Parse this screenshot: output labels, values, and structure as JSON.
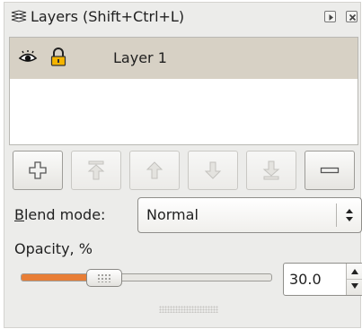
{
  "panel": {
    "title": "Layers (Shift+Ctrl+L)",
    "title_icon": "layers-icon",
    "buttons": [
      {
        "icon": "dock-toggle-icon"
      },
      {
        "icon": "close-icon"
      }
    ]
  },
  "layers": [
    {
      "name": "Layer 1",
      "visible": true,
      "locked": true,
      "selected": true
    }
  ],
  "toolbar": [
    {
      "icon": "add-layer-icon",
      "enabled": true
    },
    {
      "icon": "raise-to-top-icon",
      "enabled": false
    },
    {
      "icon": "raise-layer-icon",
      "enabled": false
    },
    {
      "icon": "lower-layer-icon",
      "enabled": false
    },
    {
      "icon": "lower-to-bottom-icon",
      "enabled": false
    },
    {
      "icon": "remove-layer-icon",
      "enabled": true
    }
  ],
  "blend": {
    "label": "Blend mode:",
    "mnemonic": "B",
    "label_rest": "lend mode:",
    "value": "Normal"
  },
  "opacity": {
    "label": "Opacity, %",
    "value": "30.0",
    "fraction": 0.3
  },
  "colors": {
    "accent": "#e87e36",
    "selected_row": "#d7d1c5",
    "panel_bg": "#ececea"
  }
}
